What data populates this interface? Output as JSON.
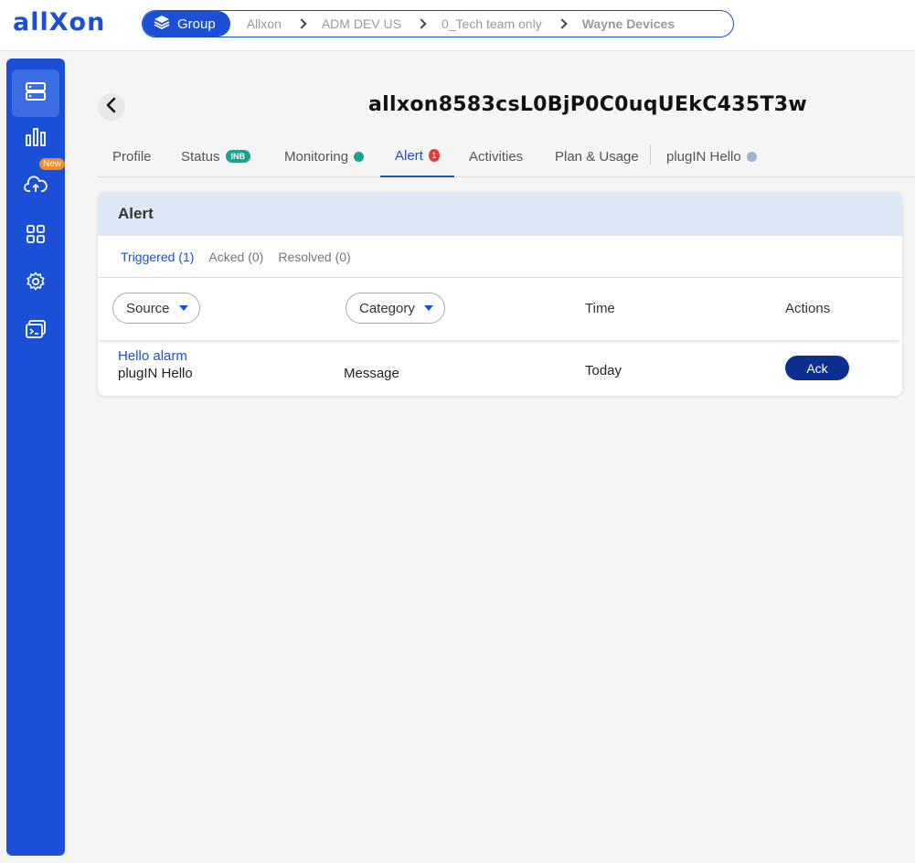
{
  "brand": {
    "logo_text": "allXon",
    "accent": "#1a4fd6"
  },
  "breadcrumb": {
    "group_label": "Group",
    "items": [
      "Allxon",
      "ADM DEV US",
      "0_Tech team only",
      "Wayne Devices"
    ]
  },
  "sidebar": {
    "items": [
      {
        "icon": "devices-icon",
        "active": true
      },
      {
        "icon": "bar-chart-icon"
      },
      {
        "icon": "cloud-upload-icon",
        "badge": "New"
      },
      {
        "icon": "apps-grid-icon"
      },
      {
        "icon": "gear-icon"
      },
      {
        "icon": "terminal-icon"
      }
    ]
  },
  "device": {
    "title": "allxon8583csL0BjP0C0uqUEkC435T3w"
  },
  "tabs": {
    "profile": "Profile",
    "status": "Status",
    "status_badge": "INB",
    "monitoring": "Monitoring",
    "alert": "Alert",
    "alert_count": "1",
    "activities": "Activities",
    "plan_usage": "Plan & Usage",
    "plugin": "plugIN Hello"
  },
  "alert_panel": {
    "header": "Alert",
    "subtabs": [
      "Triggered (1)",
      "Acked (0)",
      "Resolved (0)"
    ],
    "columns": {
      "source": "Source",
      "category": "Category",
      "time": "Time",
      "actions": "Actions"
    },
    "rows": [
      {
        "alarm_name": "Hello alarm",
        "source": "plugIN Hello",
        "category": "Message",
        "time": "Today",
        "action": "Ack"
      }
    ]
  }
}
